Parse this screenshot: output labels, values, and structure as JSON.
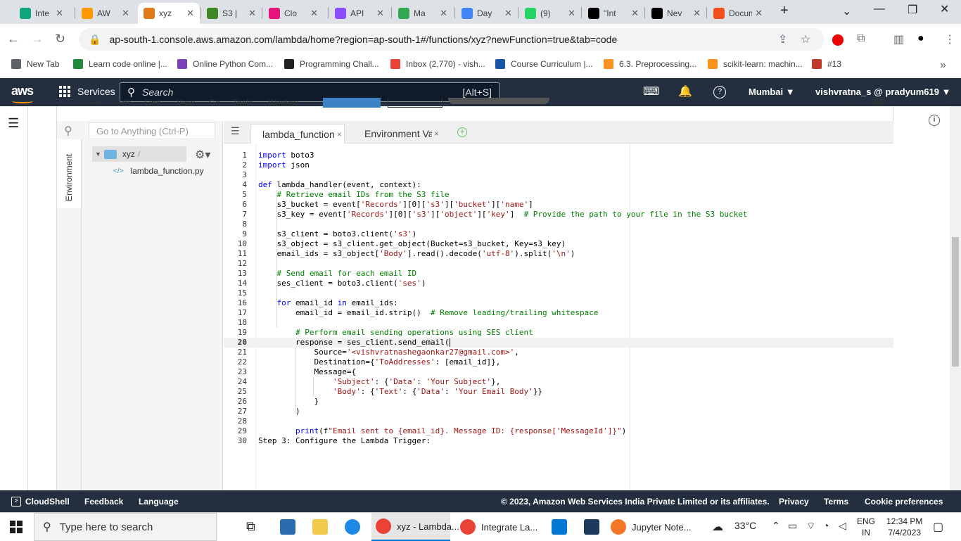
{
  "browser": {
    "tabs": [
      {
        "label": "Inte",
        "color": "#10a37f"
      },
      {
        "label": "AW",
        "color": "#ff9900"
      },
      {
        "label": "xyz",
        "color": "#e07b1a",
        "active": true
      },
      {
        "label": "S3 |",
        "color": "#3f8624"
      },
      {
        "label": "Clo",
        "color": "#e7157b"
      },
      {
        "label": "API",
        "color": "#8c4fff"
      },
      {
        "label": "Ma",
        "color": "#34a853"
      },
      {
        "label": "Day",
        "color": "#4285f4"
      },
      {
        "label": "(9)",
        "color": "#25d366"
      },
      {
        "label": "\"Int",
        "color": "#000000"
      },
      {
        "label": "Nev",
        "color": "#000000"
      },
      {
        "label": "Docume",
        "color": "#f4511e"
      }
    ],
    "url": "ap-south-1.console.aws.amazon.com/lambda/home?region=ap-south-1#/functions/xyz?newFunction=true&tab=code",
    "bookmarks": [
      {
        "label": "New Tab",
        "color": "#5f6368"
      },
      {
        "label": "Learn code online |...",
        "color": "#1f8a3c"
      },
      {
        "label": "Online Python Com...",
        "color": "#7b3fb8"
      },
      {
        "label": "Programming Chall...",
        "color": "#222222"
      },
      {
        "label": "Inbox (2,770) - vish...",
        "color": "#ea4335"
      },
      {
        "label": "Course Curriculum |...",
        "color": "#1a56a6"
      },
      {
        "label": "6.3. Preprocessing...",
        "color": "#f7931e"
      },
      {
        "label": "scikit-learn: machin...",
        "color": "#f7931e"
      },
      {
        "label": "#13",
        "color": "#c0392b"
      }
    ]
  },
  "aws": {
    "logo": "aws",
    "services": "Services",
    "search_placeholder": "Search",
    "search_shortcut": "[Alt+S]",
    "region": "Mumbai ▼",
    "account": "vishvratna_s @ pradyum619 ▼"
  },
  "ide": {
    "search_placeholder": "Go to Anything (Ctrl-P)",
    "env_tab": "Environment",
    "tree_root": "xyz",
    "tree_root_suffix": "/",
    "tree_file": "lambda_function.py",
    "tabs": [
      {
        "label": "lambda_function",
        "close": "×"
      },
      {
        "label": "Environment Var",
        "close": "×"
      }
    ],
    "add_tab": "+",
    "menu": [
      "File",
      "Edit",
      "Find",
      "View",
      "Go",
      "Tools",
      "Window"
    ],
    "code_lines": [
      {
        "n": "1",
        "html": "<span class=\"kw\">import</span> boto3"
      },
      {
        "n": "2",
        "html": "<span class=\"kw\">import</span> json"
      },
      {
        "n": "3",
        "html": ""
      },
      {
        "n": "4",
        "html": "<span class=\"kw\">def</span> lambda_handler(event, context):"
      },
      {
        "n": "5",
        "html": "    <span class=\"cmt\"># Retrieve email IDs from the S3 file</span>"
      },
      {
        "n": "6",
        "html": "    s3_bucket = event[<span class=\"str\">'Records'</span>][0][<span class=\"str\">'s3'</span>][<span class=\"str\">'bucket'</span>][<span class=\"str\">'name'</span>]"
      },
      {
        "n": "7",
        "html": "    s3_key = event[<span class=\"str\">'Records'</span>][0][<span class=\"str\">'s3'</span>][<span class=\"str\">'object'</span>][<span class=\"str\">'key'</span>]  <span class=\"cmt\"># Provide the path to your file in the S3 bucket</span>"
      },
      {
        "n": "8",
        "html": ""
      },
      {
        "n": "9",
        "html": "    s3_client = boto3.client(<span class=\"str\">'s3'</span>)"
      },
      {
        "n": "10",
        "html": "    s3_object = s3_client.get_object(Bucket=s3_bucket, Key=s3_key)"
      },
      {
        "n": "11",
        "html": "    email_ids = s3_object[<span class=\"str\">'Body'</span>].read().decode(<span class=\"str\">'utf-8'</span>).split(<span class=\"str\">'\\n'</span>)"
      },
      {
        "n": "12",
        "html": ""
      },
      {
        "n": "13",
        "html": "    <span class=\"cmt\"># Send email for each email ID</span>"
      },
      {
        "n": "14",
        "html": "    ses_client = boto3.client(<span class=\"str\">'ses'</span>)"
      },
      {
        "n": "15",
        "html": ""
      },
      {
        "n": "16",
        "html": "    <span class=\"kw\">for</span> email_id <span class=\"kw\">in</span> email_ids:"
      },
      {
        "n": "17",
        "html": "        email_id = email_id.strip()  <span class=\"cmt\"># Remove leading/trailing whitespace</span>"
      },
      {
        "n": "18",
        "html": ""
      },
      {
        "n": "19",
        "html": "        <span class=\"cmt\"># Perform email sending operations using SES client</span>"
      },
      {
        "n": "20",
        "html": "        response = ses_client.send_email(<span id=\"cursor\"></span>",
        "hl": true
      },
      {
        "n": "21",
        "html": "            Source=<span class=\"str\">'&lt;vishvratnashegaonkar27@gmail.com&gt;'</span>,"
      },
      {
        "n": "22",
        "html": "            Destination={<span class=\"str\">'ToAddresses'</span>: [email_id]},"
      },
      {
        "n": "23",
        "html": "            Message={"
      },
      {
        "n": "24",
        "html": "                <span class=\"str\">'Subject'</span>: {<span class=\"str\">'Data'</span>: <span class=\"str\">'Your Subject'</span>},"
      },
      {
        "n": "25",
        "html": "                <span class=\"str\">'Body'</span>: {<span class=\"str\">'Text'</span>: {<span class=\"str\">'Data'</span>: <span class=\"str\">'Your Email Body'</span>}}"
      },
      {
        "n": "26",
        "html": "            }"
      },
      {
        "n": "27",
        "html": "        )"
      },
      {
        "n": "28",
        "html": ""
      },
      {
        "n": "29",
        "html": "        <span class=\"kw\">print</span>(f<span class=\"str\">\"Email sent to {email_id}. Message ID: {response['MessageId']}\"</span>)"
      },
      {
        "n": "30",
        "html": "Step 3: Configure the Lambda Trigger:"
      }
    ]
  },
  "footer": {
    "cloudshell": "CloudShell",
    "feedback": "Feedback",
    "language": "Language",
    "copyright": "© 2023, Amazon Web Services India Private Limited or its affiliates.",
    "privacy": "Privacy",
    "terms": "Terms",
    "cookies": "Cookie preferences"
  },
  "taskbar": {
    "search_placeholder": "Type here to search",
    "apps": [
      {
        "label": "xyz - Lambda...",
        "color": "#ea4335",
        "active": true
      },
      {
        "label": "Integrate La...",
        "color": "#ea4335"
      },
      {
        "label": "Jupyter Note...",
        "color": "#f37726"
      }
    ],
    "weather": "33°C",
    "lang_1": "ENG",
    "lang_2": "IN",
    "time": "12:34 PM",
    "date": "7/4/2023"
  }
}
